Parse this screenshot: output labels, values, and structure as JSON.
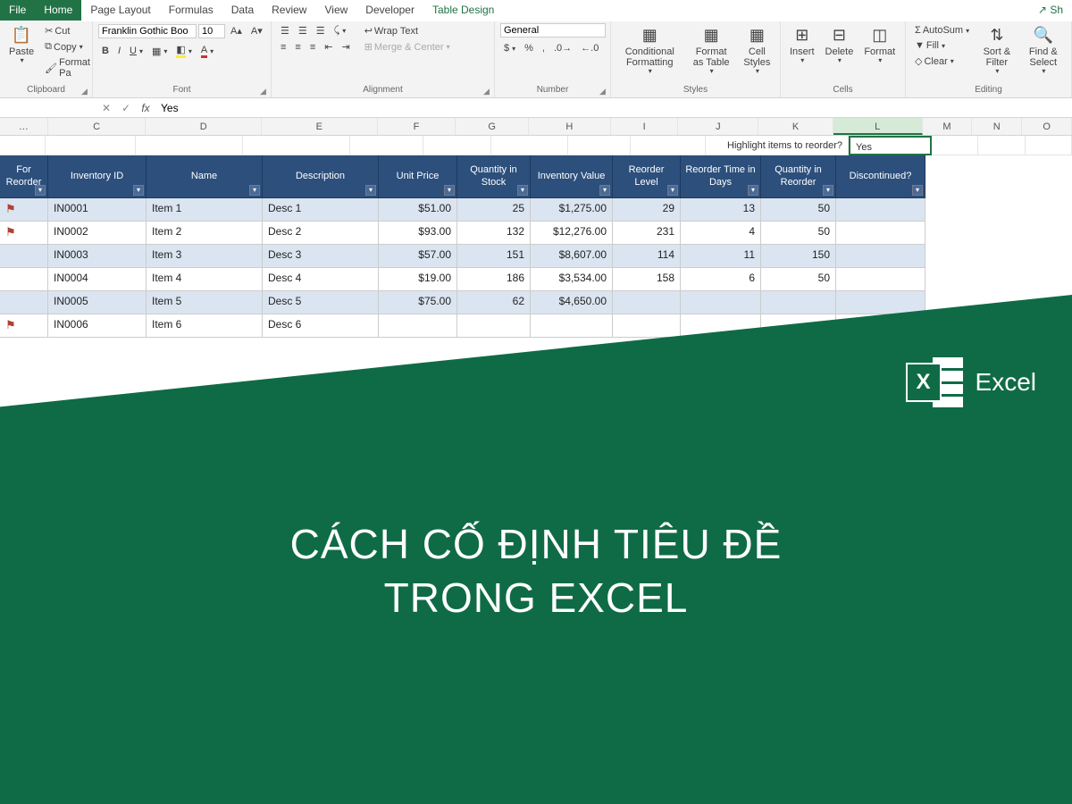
{
  "tabs": {
    "file": "File",
    "home": "Home",
    "pagelayout": "Page Layout",
    "formulas": "Formulas",
    "data": "Data",
    "review": "Review",
    "view": "View",
    "developer": "Developer",
    "tabledesign": "Table Design",
    "share": "Sh"
  },
  "clipboard": {
    "paste": "Paste",
    "cut": "Cut",
    "copy": "Copy",
    "formatpainter": "Format Pa",
    "label": "Clipboard"
  },
  "font": {
    "name": "Franklin Gothic Boo",
    "size": "10",
    "label": "Font"
  },
  "alignment": {
    "wrap": "Wrap Text",
    "merge": "Merge & Center",
    "label": "Alignment"
  },
  "number": {
    "format": "General",
    "label": "Number"
  },
  "styles": {
    "cond": "Conditional Formatting",
    "fat": "Format as Table",
    "cell": "Cell Styles",
    "label": "Styles"
  },
  "cells": {
    "insert": "Insert",
    "delete": "Delete",
    "format": "Format",
    "label": "Cells"
  },
  "editing": {
    "autosum": "AutoSum",
    "fill": "Fill",
    "clear": "Clear",
    "sort": "Sort & Filter",
    "find": "Find & Select",
    "label": "Editing"
  },
  "formula": {
    "namebox": "",
    "value": "Yes"
  },
  "cols": [
    "C",
    "D",
    "E",
    "F",
    "G",
    "H",
    "I",
    "J",
    "K",
    "L",
    "M",
    "N",
    "O"
  ],
  "highlight": {
    "label": "Highlight items to reorder?",
    "value": "Yes"
  },
  "headers": {
    "flag": "For Reorder",
    "id": "Inventory ID",
    "name": "Name",
    "desc": "Description",
    "price": "Unit Price",
    "qty": "Quantity in Stock",
    "val": "Inventory Value",
    "reord": "Reorder Level",
    "days": "Reorder Time in Days",
    "qre": "Quantity in Reorder",
    "disc": "Discontinued?"
  },
  "rows": [
    {
      "flag": true,
      "id": "IN0001",
      "name": "Item 1",
      "desc": "Desc 1",
      "price": "$51.00",
      "qty": "25",
      "val": "$1,275.00",
      "reord": "29",
      "days": "13",
      "qre": "50",
      "disc": ""
    },
    {
      "flag": true,
      "id": "IN0002",
      "name": "Item 2",
      "desc": "Desc 2",
      "price": "$93.00",
      "qty": "132",
      "val": "$12,276.00",
      "reord": "231",
      "days": "4",
      "qre": "50",
      "disc": ""
    },
    {
      "flag": false,
      "id": "IN0003",
      "name": "Item 3",
      "desc": "Desc 3",
      "price": "$57.00",
      "qty": "151",
      "val": "$8,607.00",
      "reord": "114",
      "days": "11",
      "qre": "150",
      "disc": ""
    },
    {
      "flag": false,
      "id": "IN0004",
      "name": "Item 4",
      "desc": "Desc 4",
      "price": "$19.00",
      "qty": "186",
      "val": "$3,534.00",
      "reord": "158",
      "days": "6",
      "qre": "50",
      "disc": ""
    },
    {
      "flag": false,
      "id": "IN0005",
      "name": "Item 5",
      "desc": "Desc 5",
      "price": "$75.00",
      "qty": "62",
      "val": "$4,650.00",
      "reord": "",
      "days": "",
      "qre": "",
      "disc": ""
    },
    {
      "flag": true,
      "id": "IN0006",
      "name": "Item 6",
      "desc": "Desc 6",
      "price": "",
      "qty": "",
      "val": "",
      "reord": "",
      "days": "",
      "qre": "",
      "disc": ""
    }
  ],
  "banner": {
    "logo": "Excel",
    "title1": "CÁCH CỐ ĐỊNH TIÊU ĐỀ",
    "title2": "TRONG EXCEL"
  }
}
